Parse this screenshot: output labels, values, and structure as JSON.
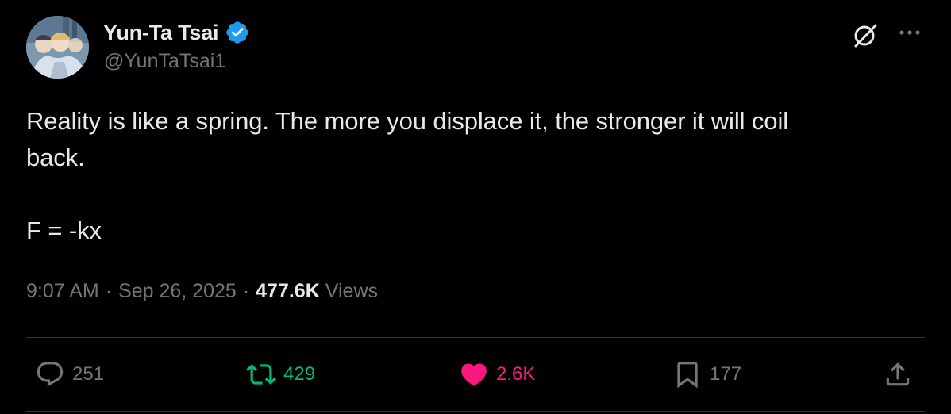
{
  "author": {
    "display_name": "Yun-Ta Tsai",
    "handle": "@YunTaTsai1",
    "verified": true
  },
  "tweet": {
    "text": "Reality is like a spring. The more you displace it, the stronger it will coil\nback.\n\nF = -kx",
    "time": "9:07 AM",
    "date": "Sep 26, 2025",
    "views_count": "477.6K",
    "views_label": "Views"
  },
  "actions": {
    "replies": "251",
    "retweets": "429",
    "likes": "2.6K",
    "bookmarks": "177"
  },
  "icons": {
    "top_right": [
      "grok-icon",
      "more-icon"
    ],
    "actions": [
      "reply-icon",
      "retweet-icon",
      "heart-icon",
      "bookmark-icon",
      "share-icon"
    ]
  },
  "colors": {
    "background": "#000000",
    "text": "#e7e9ea",
    "muted": "#71767b",
    "verified": "#1d9bf0",
    "retweet_active": "#00ba7c",
    "like_active": "#f91880"
  }
}
